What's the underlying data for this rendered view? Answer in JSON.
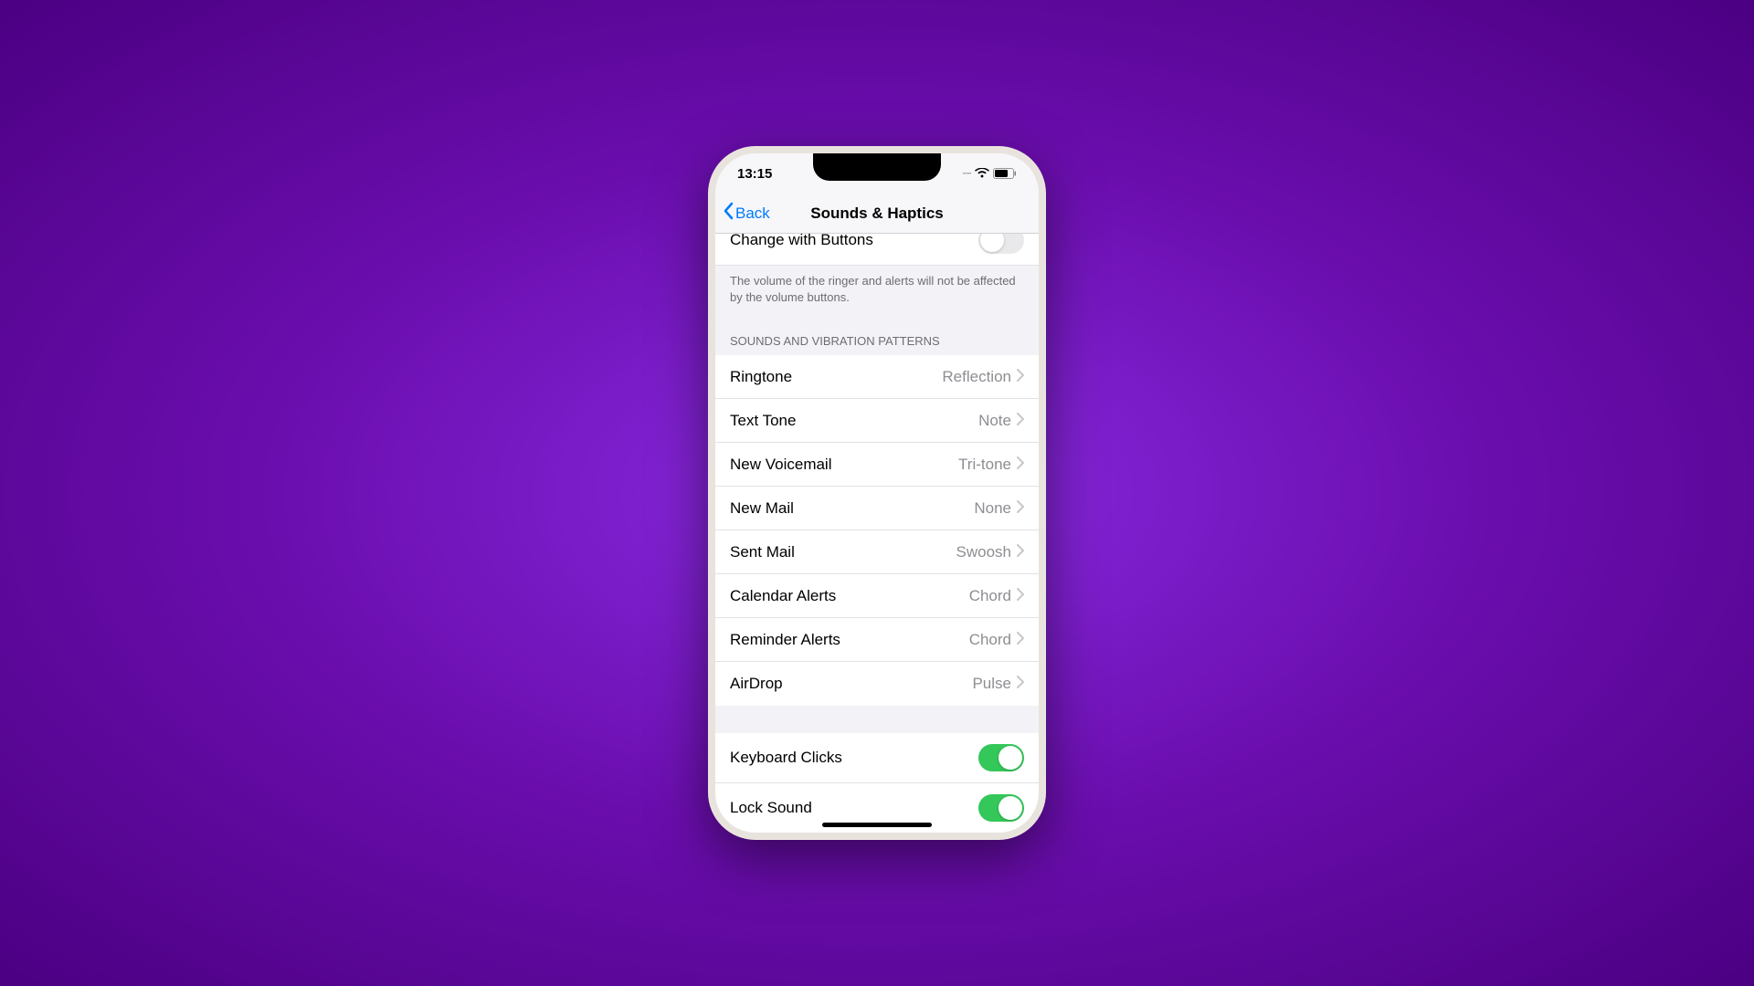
{
  "statusBar": {
    "time": "13:15"
  },
  "nav": {
    "back": "Back",
    "title": "Sounds & Haptics"
  },
  "truncatedRow": {
    "label": "Change with Buttons"
  },
  "footerText": "The volume of the ringer and alerts will not be affected by the volume buttons.",
  "sectionHeader": "SOUNDS AND VIBRATION PATTERNS",
  "sounds": [
    {
      "label": "Ringtone",
      "value": "Reflection"
    },
    {
      "label": "Text Tone",
      "value": "Note"
    },
    {
      "label": "New Voicemail",
      "value": "Tri-tone"
    },
    {
      "label": "New Mail",
      "value": "None"
    },
    {
      "label": "Sent Mail",
      "value": "Swoosh"
    },
    {
      "label": "Calendar Alerts",
      "value": "Chord"
    },
    {
      "label": "Reminder Alerts",
      "value": "Chord"
    },
    {
      "label": "AirDrop",
      "value": "Pulse"
    }
  ],
  "toggles": [
    {
      "label": "Keyboard Clicks",
      "on": true
    },
    {
      "label": "Lock Sound",
      "on": true
    }
  ]
}
